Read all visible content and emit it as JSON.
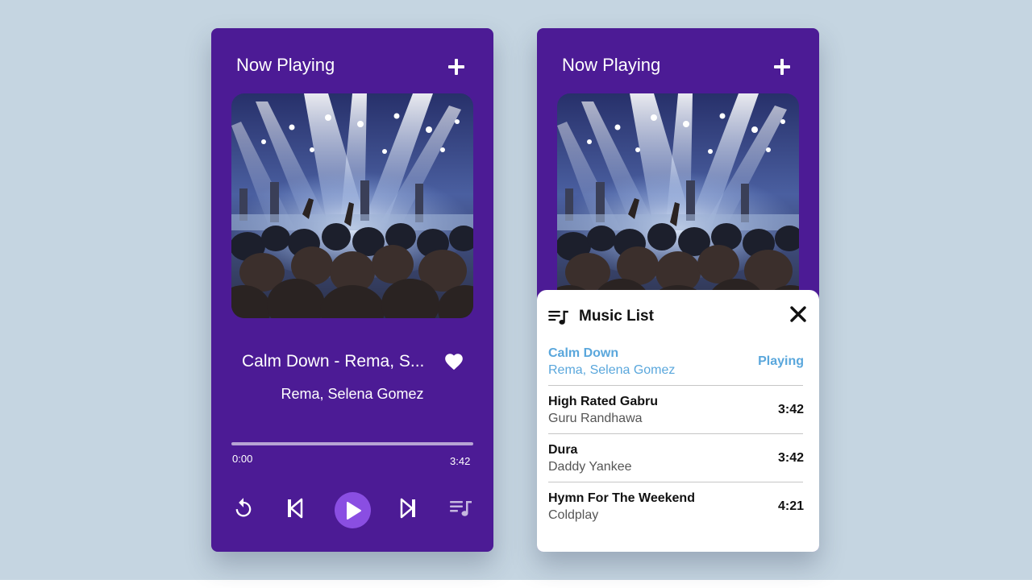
{
  "player": {
    "title": "Now Playing",
    "song_title": "Calm Down - Rema, S...",
    "song_artist": "Rema, Selena Gomez",
    "time_current": "0:00",
    "time_total": "3:42",
    "progress": 0.0
  },
  "icons": {
    "add": "plus-icon",
    "favorite": "heart-icon",
    "repeat": "repeat-icon",
    "previous": "skip-previous-icon",
    "play": "play-icon",
    "next": "skip-next-icon",
    "playlist": "queue-music-icon",
    "close": "close-icon"
  },
  "music_list": {
    "title": "Music List",
    "items": [
      {
        "title": "Calm Down",
        "artist": "Rema, Selena Gomez",
        "right": "Playing",
        "active": true
      },
      {
        "title": "High Rated Gabru",
        "artist": "Guru Randhawa",
        "right": "3:42",
        "active": false
      },
      {
        "title": "Dura",
        "artist": "Daddy Yankee",
        "right": "3:42",
        "active": false
      },
      {
        "title": "Hymn For The Weekend",
        "artist": "Coldplay",
        "right": "4:21",
        "active": false
      }
    ]
  },
  "colors": {
    "card": "#4c1b95",
    "play_button": "#8a4ee2",
    "active_track": "#5aa7dc",
    "backdrop": "#c5d5e1"
  }
}
